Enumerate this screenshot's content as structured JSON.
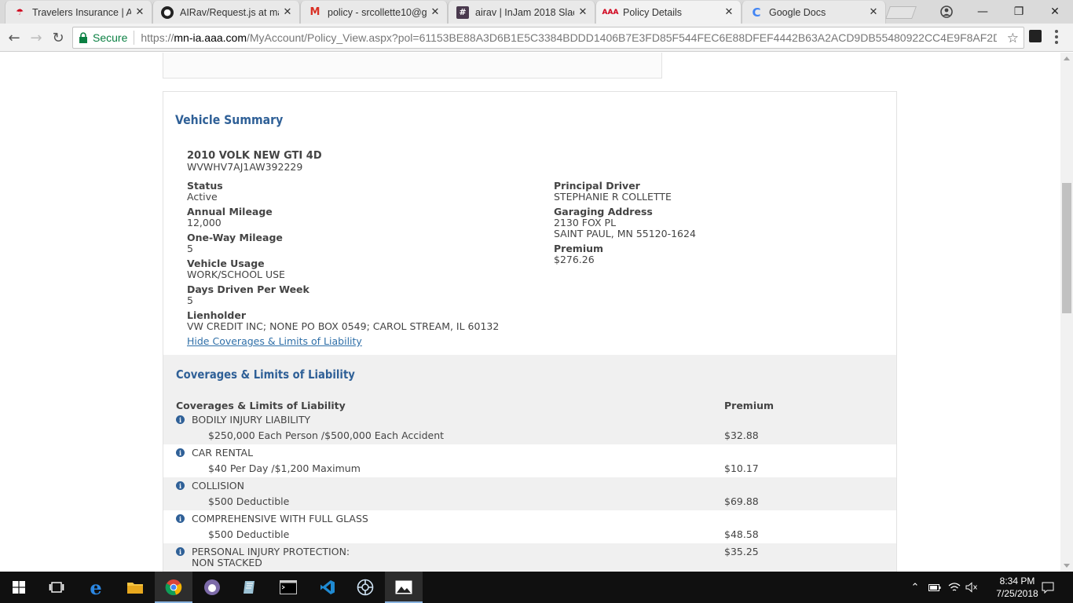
{
  "browser": {
    "tabs": [
      {
        "title": "Travelers Insurance | Aut",
        "icon": "travelers-umbrella-icon"
      },
      {
        "title": "AIRav/Request.js at mas",
        "icon": "github-icon"
      },
      {
        "title": "policy - srcollette10@gr",
        "icon": "gmail-icon"
      },
      {
        "title": "airav | InJam 2018 Slack",
        "icon": "slack-icon"
      },
      {
        "title": "Policy Details",
        "icon": "aaa-icon",
        "active": true
      },
      {
        "title": "Google Docs",
        "icon": "google-loading-icon"
      }
    ],
    "secure_label": "Secure",
    "url_scheme": "https://",
    "url_host": "mn-ia.aaa.com",
    "url_rest": "/MyAccount/Policy_View.aspx?pol=61153BE88A3D6B1E5C3384BDDD1406B7E3FD85F544FEC6E88DFEF4442B63A2ACD9DB55480922CC4E9F8AF2DDDF2A..."
  },
  "vehicle_summary": {
    "heading": "Vehicle Summary",
    "vehicle_name": "2010 VOLK NEW GTI 4D",
    "vin": "WVWHV7AJ1AW392229",
    "left_fields": [
      {
        "label": "Status",
        "value": "Active"
      },
      {
        "label": "Annual Mileage",
        "value": "12,000"
      },
      {
        "label": "One-Way Mileage",
        "value": "5"
      },
      {
        "label": "Vehicle Usage",
        "value": "WORK/SCHOOL USE"
      },
      {
        "label": "Days Driven Per Week",
        "value": "5"
      },
      {
        "label": "Lienholder",
        "value": "VW CREDIT INC; NONE PO BOX 0549; CAROL STREAM, IL 60132"
      }
    ],
    "principal_driver_label": "Principal Driver",
    "principal_driver": "STEPHANIE R COLLETTE",
    "garaging_label": "Garaging Address",
    "garaging_line1": "2130 FOX PL",
    "garaging_line2": "SAINT PAUL, MN 55120-1624",
    "premium_label": "Premium",
    "premium": "$276.26",
    "hide_link": "Hide Coverages & Limits of Liability"
  },
  "coverages": {
    "heading": "Coverages & Limits of Liability",
    "col_coverage": "Coverages & Limits of Liability",
    "col_premium": "Premium",
    "rows": [
      {
        "name": "BODILY INJURY LIABILITY",
        "detail": "$250,000 Each Person /$500,000 Each Accident",
        "premium": "$32.88"
      },
      {
        "name": "CAR RENTAL",
        "detail": "$40 Per Day /$1,200 Maximum",
        "premium": "$10.17"
      },
      {
        "name": "COLLISION",
        "detail": "$500 Deductible",
        "premium": "$69.88"
      },
      {
        "name": "COMPREHENSIVE WITH FULL GLASS",
        "detail": "$500 Deductible",
        "premium": "$48.58"
      },
      {
        "name": "PERSONAL INJURY PROTECTION:",
        "name2": "NON STACKED",
        "detail": "",
        "premium": "$35.25"
      }
    ]
  },
  "taskbar": {
    "time": "8:34 PM",
    "date": "7/25/2018"
  }
}
